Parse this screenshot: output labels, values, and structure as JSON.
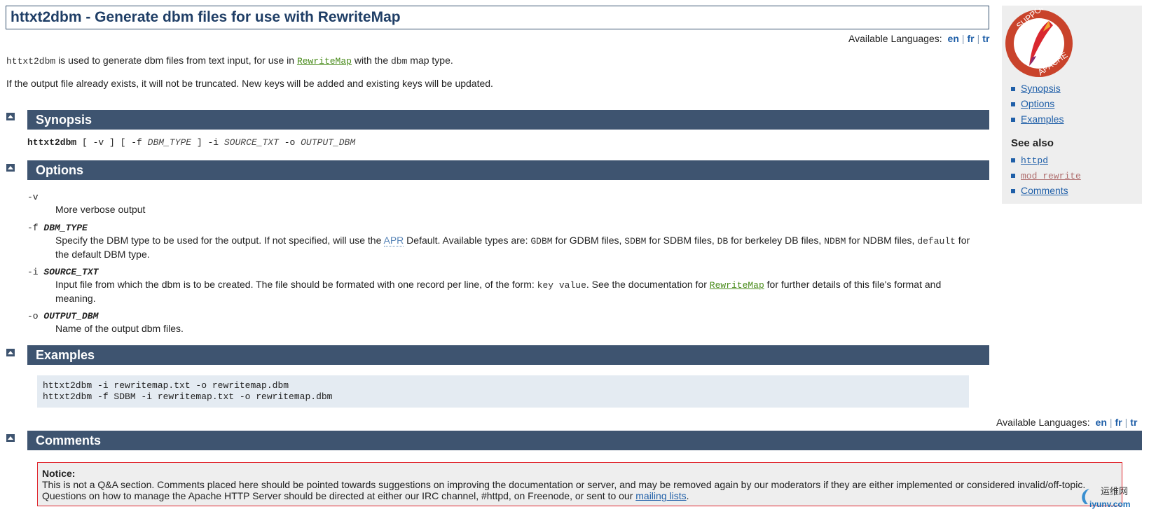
{
  "title": "httxt2dbm - Generate dbm files for use with RewriteMap",
  "languages": {
    "label": "Available Languages:",
    "items": [
      "en",
      "fr",
      "tr"
    ]
  },
  "intro": {
    "cmd": "httxt2dbm",
    "text1": " is used to generate dbm files from text input, for use in ",
    "link": "RewriteMap",
    "text2": " with the ",
    "code": "dbm",
    "text3": " map type."
  },
  "intro2": "If the output file already exists, it will not be truncated. New keys will be added and existing keys will be updated.",
  "sections": {
    "synopsis": "Synopsis",
    "options": "Options",
    "examples": "Examples",
    "comments": "Comments"
  },
  "synopsis": {
    "cmd": "httxt2dbm",
    "p1": " [ -v ] [ -f ",
    "dbm_type": "DBM_TYPE",
    "p2": " ] -i ",
    "source": "SOURCE_TXT",
    "p3": " -o ",
    "output": "OUTPUT_DBM"
  },
  "options": [
    {
      "flag": "-v",
      "arg": "",
      "desc": "More verbose output"
    },
    {
      "flag": "-f",
      "arg": "DBM_TYPE",
      "d1": "Specify the DBM type to be used for the output. If not specified, will use the ",
      "apr": "APR",
      "d2": " Default. Available types are: ",
      "t1": "GDBM",
      "d3": " for GDBM files, ",
      "t2": "SDBM",
      "d4": " for SDBM files, ",
      "t3": "DB",
      "d5": " for berkeley DB files, ",
      "t4": "NDBM",
      "d6": " for NDBM files, ",
      "t5": "default",
      "d7": " for the default DBM type."
    },
    {
      "flag": "-i",
      "arg": "SOURCE_TXT",
      "d1": "Input file from which the dbm is to be created. The file should be formated with one record per line, of the form: ",
      "code": "key value",
      "d2": ". See the documentation for ",
      "link": "RewriteMap",
      "d3": " for further details of this file's format and meaning."
    },
    {
      "flag": "-o",
      "arg": "OUTPUT_DBM",
      "desc": "Name of the output dbm files."
    }
  ],
  "examples": [
    "httxt2dbm -i rewritemap.txt -o rewritemap.dbm",
    "httxt2dbm -f SDBM -i rewritemap.txt -o rewritemap.dbm"
  ],
  "notice": {
    "heading": "Notice:",
    "line1": "This is not a Q&A section. Comments placed here should be pointed towards suggestions on improving the documentation or server, and may be removed again by our moderators if they are either implemented or considered invalid/off-topic.",
    "line2a": "Questions on how to manage the Apache HTTP Server should be directed at either our IRC channel, #httpd, on Freenode, or sent to our ",
    "link": "mailing lists",
    "line2b": "."
  },
  "sidebar": {
    "logo_text": [
      "SUPPORT",
      "APACHE"
    ],
    "toc": [
      "Synopsis",
      "Options",
      "Examples"
    ],
    "see_also_label": "See also",
    "see_also": [
      "httpd",
      "mod_rewrite",
      "Comments"
    ]
  },
  "watermark": {
    "cn": "运维网",
    "domain": "iyunv.com"
  },
  "colors": {
    "section_bar": "#3e5470",
    "link": "#1f5fa8",
    "module_link": "#4a8c1c",
    "notice_border": "#e0262e"
  }
}
